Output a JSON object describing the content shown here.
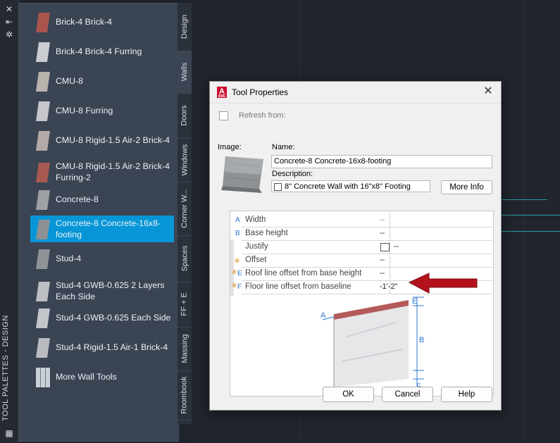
{
  "palette": {
    "title": "TOOL PALETTES - DESIGN",
    "items": [
      {
        "label": "Brick-4 Brick-4",
        "color": "#a9554e"
      },
      {
        "label": "Brick-4 Brick-4 Furring",
        "color": "#c9ccd1"
      },
      {
        "label": "CMU-8",
        "color": "#b9b3ad"
      },
      {
        "label": "CMU-8 Furring",
        "color": "#c5c7cb"
      },
      {
        "label": "CMU-8 Rigid-1.5 Air-2 Brick-4",
        "color": "#b3aaa7"
      },
      {
        "label": "CMU-8 Rigid-1.5 Air-2 Brick-4 Furring-2",
        "color": "#a85a52"
      },
      {
        "label": "Concrete-8",
        "color": "#9ea1a4"
      },
      {
        "label": "Concrete-8 Concrete-16x8-footing",
        "color": "#8e9194"
      },
      {
        "label": "Stud-4",
        "color": "#8f9398"
      },
      {
        "label": "Stud-4 GWB-0.625 2 Layers Each Side",
        "color": "#bcbfc3"
      },
      {
        "label": "Stud-4 GWB-0.625 Each Side",
        "color": "#c2c5c9"
      },
      {
        "label": "Stud-4 Rigid-1.5 Air-1 Brick-4",
        "color": "#b8bbc0"
      },
      {
        "label": "More Wall Tools",
        "color": "#c9d0d8"
      }
    ],
    "selected_index": 7,
    "tabs": [
      "Design",
      "Walls",
      "Doors",
      "Windows",
      "Corner W...",
      "Spaces",
      "FF + E",
      "Massing",
      "Roombook"
    ],
    "active_tab": "Walls"
  },
  "dialog": {
    "title": "Tool Properties",
    "app_icon_letter": "A",
    "app_icon_small": "ARC",
    "refresh_label": "Refresh from:",
    "image_label": "Image:",
    "name_label": "Name:",
    "name_value": "Concrete-8 Concrete-16x8-footing",
    "description_label": "Description:",
    "description_value": "8\" Concrete Wall with 16\"x8\" Footing",
    "more_info_label": "More Info",
    "properties": [
      {
        "key": "A",
        "label": "Width",
        "value": "--",
        "dim": true
      },
      {
        "key": "B",
        "label": "Base height",
        "value": "--",
        "dim": false
      },
      {
        "key": "",
        "label": "Justify",
        "value": "--",
        "dim": false
      },
      {
        "key": "",
        "label": "Offset",
        "value": "--",
        "dim": false
      },
      {
        "key": "E",
        "label": "Roof line offset from base height",
        "value": "--",
        "dim": false
      },
      {
        "key": "F",
        "label": "Floor line offset from baseline",
        "value": "-1'-2\"",
        "dim": false
      }
    ],
    "diagram_labels": {
      "e": "E",
      "a": "A",
      "b": "B",
      "f": "F"
    },
    "ok_label": "OK",
    "cancel_label": "Cancel",
    "help_label": "Help"
  }
}
